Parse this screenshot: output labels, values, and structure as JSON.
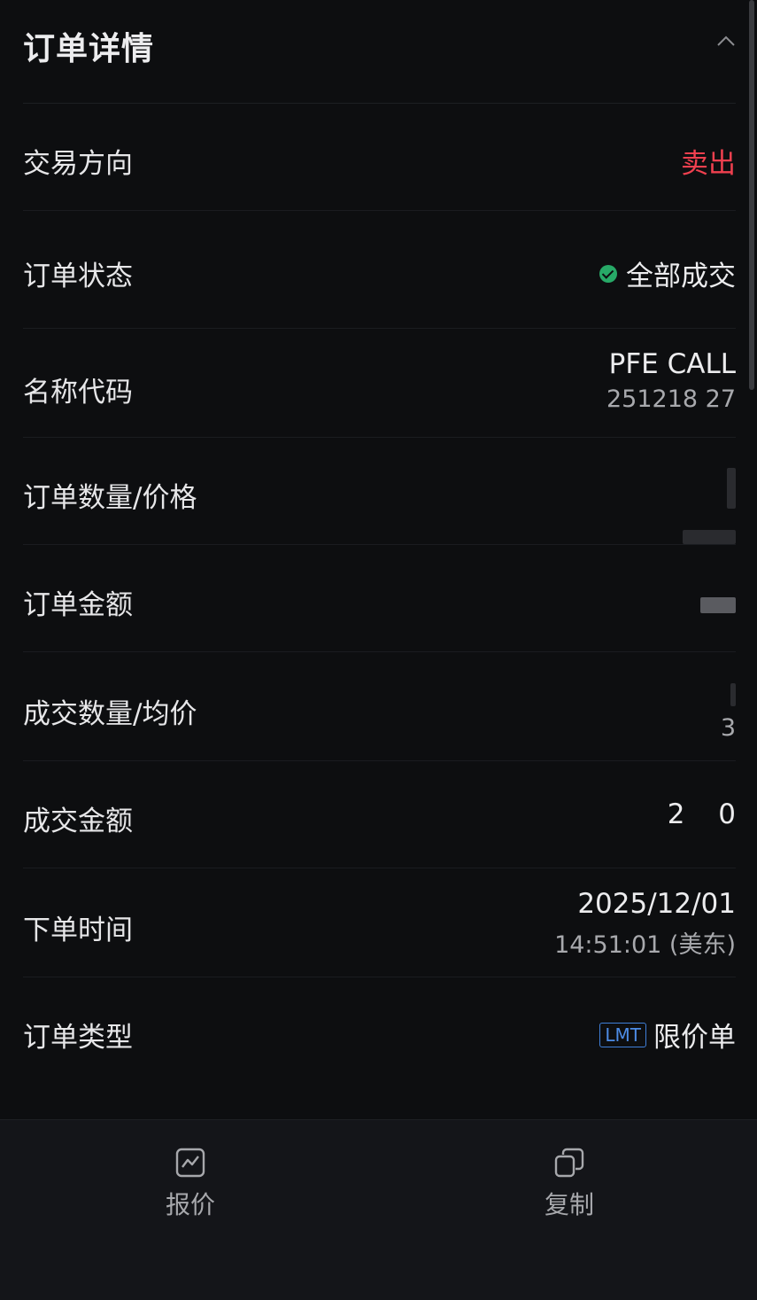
{
  "header": {
    "title": "订单详情",
    "collapse_icon": "chevron-up-icon"
  },
  "rows": {
    "direction": {
      "label": "交易方向",
      "value": "卖出"
    },
    "status": {
      "label": "订单状态",
      "value": "全部成交",
      "icon": "check-circle-icon"
    },
    "name_code": {
      "label": "名称代码",
      "value": "PFE CALL",
      "sub_value": "251218 27"
    },
    "order_qty_price": {
      "label": "订单数量/价格"
    },
    "order_amount": {
      "label": "订单金额"
    },
    "filled_qty_avg": {
      "label": "成交数量/均价",
      "sub_value": "3"
    },
    "filled_amount": {
      "label": "成交金额",
      "value": "2 0"
    },
    "order_time": {
      "label": "下单时间",
      "value": "2025/12/01",
      "sub_value": "14:51:01 (美东)"
    },
    "order_type": {
      "label": "订单类型",
      "badge": "LMT",
      "value": "限价单"
    }
  },
  "bottom_bar": {
    "quote": {
      "label": "报价",
      "icon": "chart-icon"
    },
    "copy": {
      "label": "复制",
      "icon": "copy-icon"
    }
  },
  "colors": {
    "background": "#0d0e10",
    "sell": "#f0404f",
    "filled_status": "#27a967",
    "lmt_badge": "#3f7fd8"
  }
}
